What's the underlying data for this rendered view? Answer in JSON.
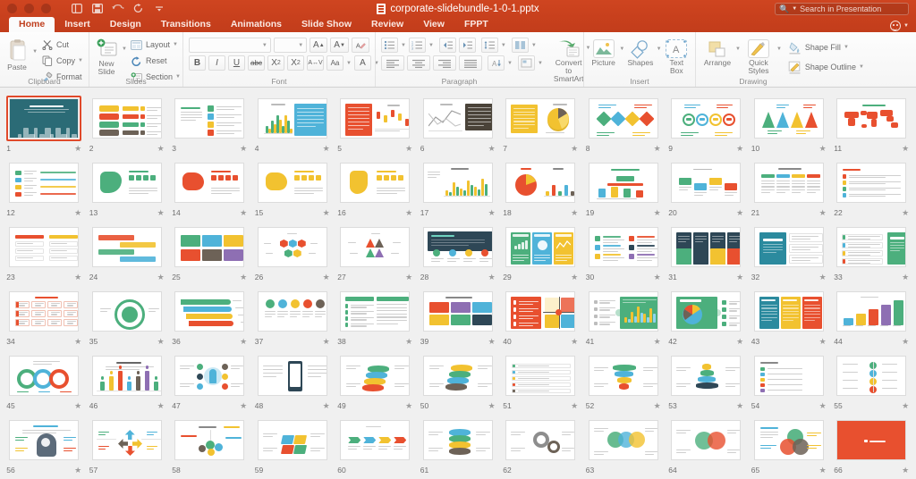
{
  "window": {
    "document_title": "corporate-slidebundle-1-0-1.pptx",
    "traffic_lights": [
      "close",
      "minimize",
      "zoom"
    ],
    "quick_access": [
      "sidebar-toggle-icon",
      "save-icon",
      "undo-icon",
      "redo-icon",
      "customize-toolbar-icon"
    ]
  },
  "search": {
    "placeholder": "Search in Presentation",
    "icon": "search-icon"
  },
  "help": {
    "icon": "smiley-icon"
  },
  "tabs": [
    {
      "label": "Home",
      "active": true
    },
    {
      "label": "Insert",
      "active": false
    },
    {
      "label": "Design",
      "active": false
    },
    {
      "label": "Transitions",
      "active": false
    },
    {
      "label": "Animations",
      "active": false
    },
    {
      "label": "Slide Show",
      "active": false
    },
    {
      "label": "Review",
      "active": false
    },
    {
      "label": "View",
      "active": false
    },
    {
      "label": "FPPT",
      "active": false
    }
  ],
  "ribbon": {
    "groups": [
      {
        "name": "Clipboard",
        "label": "Clipboard",
        "paste_label": "Paste",
        "items": [
          {
            "label": "Cut",
            "icon": "scissors-icon"
          },
          {
            "label": "Copy",
            "icon": "copy-icon"
          },
          {
            "label": "Format",
            "icon": "format-painter-icon"
          }
        ]
      },
      {
        "name": "Slides",
        "label": "Slides",
        "new_slide_label": "New\nSlide",
        "new_slide_line1": "New",
        "new_slide_line2": "Slide",
        "items": [
          {
            "label": "Layout",
            "icon": "layout-icon"
          },
          {
            "label": "Reset",
            "icon": "reset-icon"
          },
          {
            "label": "Section",
            "icon": "section-icon"
          }
        ]
      },
      {
        "name": "Font",
        "label": "Font",
        "font_name_value": "",
        "font_size_value": "",
        "grow_font": "A",
        "shrink_font": "A",
        "clear_formatting": "A",
        "buttons": [
          "B",
          "I",
          "U",
          "abc",
          "X²",
          "X₂",
          "AV",
          "Aa",
          "A"
        ]
      },
      {
        "name": "Paragraph",
        "label": "Paragraph",
        "convert_label_line1": "Convert to",
        "convert_label_line2": "SmartArt",
        "buttons": [
          "bullets",
          "numbering",
          "decrease-indent",
          "increase-indent",
          "line-spacing",
          "columns",
          "align-left",
          "align-center",
          "align-right",
          "justify",
          "text-direction",
          "align-text"
        ]
      },
      {
        "name": "Insert",
        "label": "Insert",
        "items": [
          {
            "label": "Picture",
            "icon": "picture-icon"
          },
          {
            "label": "Shapes",
            "icon": "shapes-icon"
          },
          {
            "label_line1": "Text",
            "label_line2": "Box",
            "icon": "text-box-icon"
          }
        ]
      },
      {
        "name": "Drawing",
        "label": "Drawing",
        "items": [
          {
            "label": "Arrange",
            "icon": "arrange-icon"
          },
          {
            "label_line1": "Quick",
            "label_line2": "Styles",
            "icon": "quick-styles-icon"
          }
        ],
        "menu_items": [
          {
            "label": "Shape Fill",
            "icon": "shape-fill-icon"
          },
          {
            "label": "Shape Outline",
            "icon": "shape-outline-icon"
          }
        ]
      }
    ]
  },
  "sorter": {
    "columns": 11,
    "selected_slide": 1,
    "total_slides": 66,
    "slides": [
      {
        "n": 1,
        "star": true,
        "art": "title-city"
      },
      {
        "n": 2,
        "star": true,
        "art": "stack-list"
      },
      {
        "n": 3,
        "star": true,
        "art": "text-icon-list"
      },
      {
        "n": 4,
        "star": true,
        "art": "bar-chart-panel"
      },
      {
        "n": 5,
        "star": true,
        "art": "red-panel-candles"
      },
      {
        "n": 6,
        "star": true,
        "art": "line-chart-dark"
      },
      {
        "n": 7,
        "star": true,
        "art": "yellow-panel-pie"
      },
      {
        "n": 8,
        "star": true,
        "art": "diamond-chain"
      },
      {
        "n": 9,
        "star": true,
        "art": "circle-numbers"
      },
      {
        "n": 10,
        "star": true,
        "art": "triangles"
      },
      {
        "n": 11,
        "star": true,
        "art": "world-map"
      },
      {
        "n": 12,
        "star": true,
        "art": "flag-list"
      },
      {
        "n": 13,
        "star": true,
        "art": "map-north-america"
      },
      {
        "n": 14,
        "star": true,
        "art": "map-australia"
      },
      {
        "n": 15,
        "star": true,
        "art": "map-yellow"
      },
      {
        "n": 16,
        "star": true,
        "art": "map-africa"
      },
      {
        "n": 17,
        "star": true,
        "art": "column-chart"
      },
      {
        "n": 18,
        "star": true,
        "art": "two-pies"
      },
      {
        "n": 19,
        "star": true,
        "art": "podium"
      },
      {
        "n": 20,
        "star": true,
        "art": "process-arrows"
      },
      {
        "n": 21,
        "star": true,
        "art": "timeline-cols"
      },
      {
        "n": 22,
        "star": true,
        "art": "steps-list"
      },
      {
        "n": 23,
        "star": true,
        "art": "two-col-boxes"
      },
      {
        "n": 24,
        "star": true,
        "art": "zigzag-rows"
      },
      {
        "n": 25,
        "star": true,
        "art": "matrix-boxes"
      },
      {
        "n": 26,
        "star": true,
        "art": "hex-cluster"
      },
      {
        "n": 27,
        "star": true,
        "art": "hex-triangles"
      },
      {
        "n": 28,
        "star": true,
        "art": "dark-header-steps"
      },
      {
        "n": 29,
        "star": true,
        "art": "three-panels-charts"
      },
      {
        "n": 30,
        "star": true,
        "art": "icon-rows"
      },
      {
        "n": 31,
        "star": true,
        "art": "four-tiles"
      },
      {
        "n": 32,
        "star": true,
        "art": "teal-title-cols"
      },
      {
        "n": 33,
        "star": true,
        "art": "green-side-rows"
      },
      {
        "n": 34,
        "star": true,
        "art": "red-boxes-grid"
      },
      {
        "n": 35,
        "star": true,
        "art": "circle-arrows"
      },
      {
        "n": 36,
        "star": true,
        "art": "layered-bars"
      },
      {
        "n": 37,
        "star": true,
        "art": "letter-steps"
      },
      {
        "n": 38,
        "star": true,
        "art": "green-title-list"
      },
      {
        "n": 39,
        "star": true,
        "art": "purple-grid"
      },
      {
        "n": 40,
        "star": true,
        "art": "red-panel-quad"
      },
      {
        "n": 41,
        "star": true,
        "art": "green-chart-panel"
      },
      {
        "n": 42,
        "star": true,
        "art": "green-pie-panel"
      },
      {
        "n": 43,
        "star": true,
        "art": "teal-three-col"
      },
      {
        "n": 44,
        "star": true,
        "art": "blocks-3d"
      },
      {
        "n": 45,
        "star": true,
        "art": "three-rings"
      },
      {
        "n": 46,
        "star": true,
        "art": "people-bars"
      },
      {
        "n": 47,
        "star": true,
        "art": "bulb-circles"
      },
      {
        "n": 48,
        "star": true,
        "art": "phone-mockup"
      },
      {
        "n": 49,
        "star": true,
        "art": "layers-stack"
      },
      {
        "n": 50,
        "star": true,
        "art": "layers-green"
      },
      {
        "n": 51,
        "star": true,
        "art": "list-rows"
      },
      {
        "n": 52,
        "star": true,
        "art": "cone-chart"
      },
      {
        "n": 53,
        "star": true,
        "art": "cone-chart-2"
      },
      {
        "n": 54,
        "star": true,
        "art": "row-list-plain"
      },
      {
        "n": 55,
        "star": true,
        "art": "tree-nodes"
      },
      {
        "n": 56,
        "star": true,
        "art": "head-puzzle"
      },
      {
        "n": 57,
        "star": false,
        "art": "four-arrows"
      },
      {
        "n": 58,
        "star": false,
        "art": "mindmap"
      },
      {
        "n": 59,
        "star": false,
        "art": "puzzle-flat"
      },
      {
        "n": 60,
        "star": false,
        "art": "arrow-steps"
      },
      {
        "n": 61,
        "star": false,
        "art": "layers-blue"
      },
      {
        "n": 62,
        "star": false,
        "art": "gears"
      },
      {
        "n": 63,
        "star": false,
        "art": "circles-three"
      },
      {
        "n": 64,
        "star": false,
        "art": "venn-two"
      },
      {
        "n": 65,
        "star": true,
        "art": "venn-three"
      },
      {
        "n": 66,
        "star": true,
        "art": "closing-red"
      }
    ]
  },
  "colors": {
    "brand": "#c8401d",
    "titlebar": "#cf4520",
    "selection": "#e0492a",
    "canvas": "#f0f0f0",
    "ribbon": "#f5f5f5",
    "accent_teal": "#2b8a9e",
    "accent_red": "#e8502f",
    "accent_green": "#4caf7d",
    "accent_yellow": "#f2c230",
    "accent_blue": "#4fb3d9"
  }
}
